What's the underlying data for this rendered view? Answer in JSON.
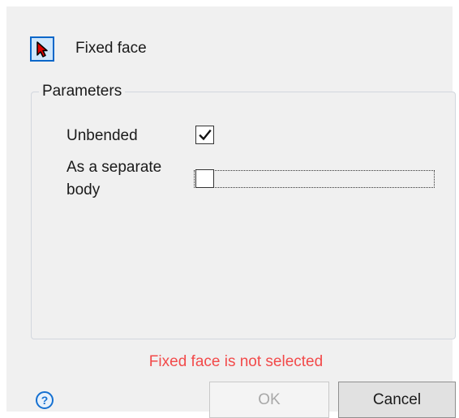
{
  "selector": {
    "icon": "pointer-arrow-icon",
    "label": "Fixed face",
    "accent": "#0a67c9",
    "arrow_color": "#e00000"
  },
  "parameters": {
    "title": "Parameters",
    "unbended": {
      "label": "Unbended",
      "checked": true
    },
    "separate_body": {
      "label": "As a separate body",
      "checked": false
    }
  },
  "status": {
    "error_text": "Fixed face is not selected",
    "color": "#f24a4a"
  },
  "footer": {
    "help_icon": "help-icon",
    "help_glyph": "?",
    "ok_label": "OK",
    "ok_enabled": false,
    "cancel_label": "Cancel"
  }
}
